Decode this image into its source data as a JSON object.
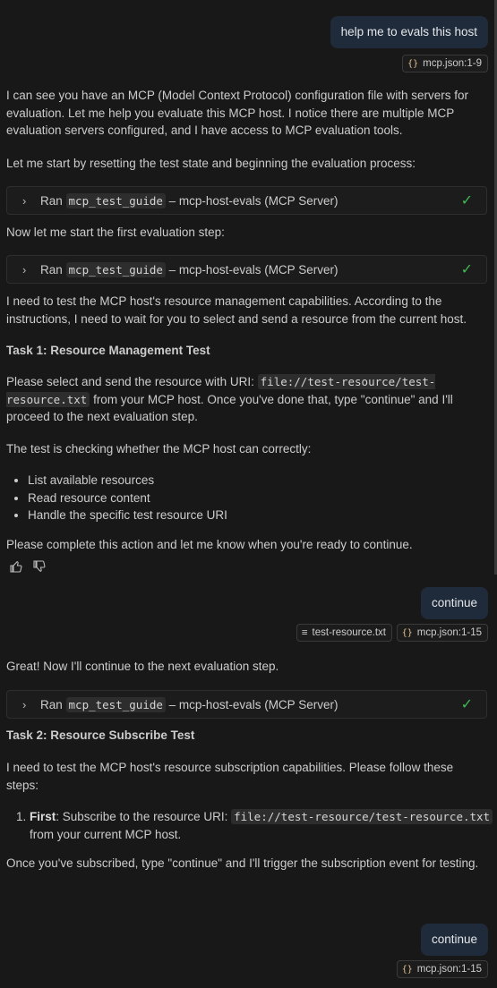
{
  "user_msg_1": "help me to evals this host",
  "chip_1": {
    "icon": "{}",
    "name": "mcp.json",
    "range": ":1-9"
  },
  "resp1": {
    "p1": "I can see you have an MCP (Model Context Protocol) configuration file with servers for evaluation. Let me help you evaluate this MCP host. I notice there are multiple MCP evaluation servers configured, and I have access to MCP evaluation tools.",
    "p2": "Let me start by resetting the test state and beginning the evaluation process:",
    "tool_ran": "Ran",
    "tool_name": "mcp_test_guide",
    "tool_suffix": "– mcp-host-evals (MCP Server)",
    "p3": "Now let me start the first evaluation step:",
    "p4": "I need to test the MCP host's resource management capabilities. According to the instructions, I need to wait for you to select and send a resource from the current host.",
    "task1": "Task 1: Resource Management Test",
    "p5_a": "Please select and send the resource with URI: ",
    "p5_code": "file://test-resource/test-resource.txt",
    "p5_b": " from your MCP host. Once you've done that, type \"continue\" and I'll proceed to the next evaluation step.",
    "p6": "The test is checking whether the MCP host can correctly:",
    "bullets": [
      "List available resources",
      "Read resource content",
      "Handle the specific test resource URI"
    ],
    "p7": "Please complete this action and let me know when you're ready to continue."
  },
  "user_msg_2": "continue",
  "chip_file": {
    "icon": "≡",
    "name": "test-resource.txt"
  },
  "chip_2": {
    "icon": "{}",
    "name": "mcp.json",
    "range": ":1-15"
  },
  "resp2": {
    "p1": "Great! Now I'll continue to the next evaluation step.",
    "task2": "Task 2: Resource Subscribe Test",
    "p2": "I need to test the MCP host's resource subscription capabilities. Please follow these steps:",
    "step1_bold": "First",
    "step1_a": ": Subscribe to the resource URI: ",
    "step1_code": "file://test-resource/test-resource.txt",
    "step1_b": " from your current MCP host.",
    "p3": "Once you've subscribed, type \"continue\" and I'll trigger the subscription event for testing."
  },
  "user_msg_3": "continue",
  "chip_3": {
    "icon": "{}",
    "name": "mcp.json",
    "range": ":1-15"
  }
}
